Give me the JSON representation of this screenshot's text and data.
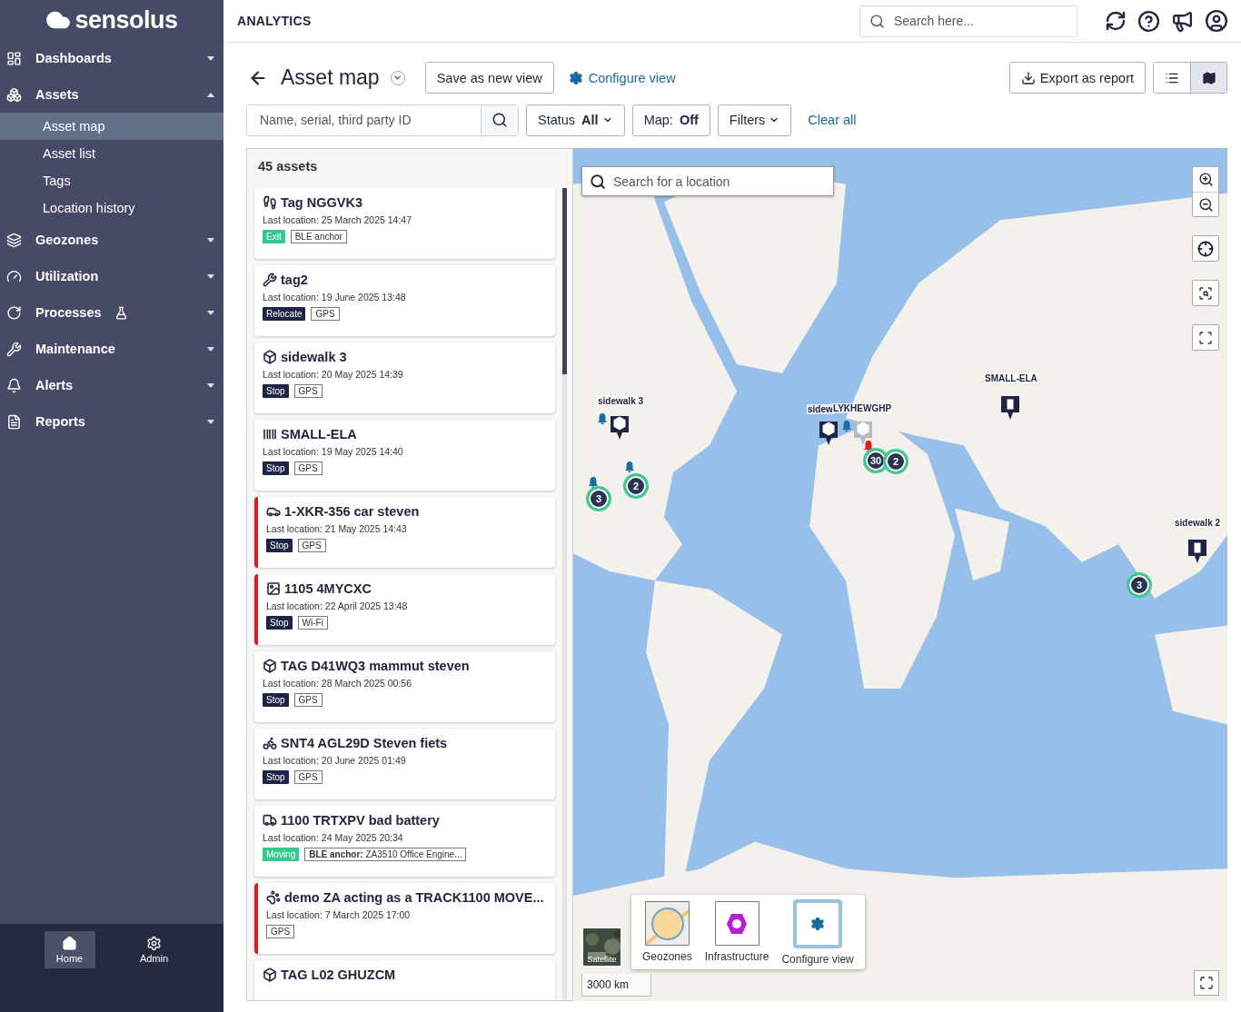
{
  "sidebar": {
    "logo": "sensolus",
    "items": [
      {
        "label": "Dashboards",
        "expanded": false
      },
      {
        "label": "Assets",
        "expanded": true,
        "children": [
          {
            "label": "Asset map",
            "selected": true
          },
          {
            "label": "Asset list",
            "selected": false
          },
          {
            "label": "Tags",
            "selected": false
          },
          {
            "label": "Location history",
            "selected": false
          }
        ]
      },
      {
        "label": "Geozones",
        "expanded": false
      },
      {
        "label": "Utilization",
        "expanded": false
      },
      {
        "label": "Processes",
        "expanded": false,
        "lab": true
      },
      {
        "label": "Maintenance",
        "expanded": false
      },
      {
        "label": "Alerts",
        "expanded": false
      },
      {
        "label": "Reports",
        "expanded": false
      }
    ],
    "footer": [
      {
        "label": "Home",
        "selected": true
      },
      {
        "label": "Admin",
        "selected": false
      }
    ]
  },
  "topbar": {
    "section": "ANALYTICS",
    "search": {
      "placeholder": "Search here..."
    }
  },
  "header": {
    "title": "Asset map",
    "save_button": "Save as new view",
    "configure_link": "Configure view",
    "export_button": "Export as report",
    "view_toggle": [
      {
        "selected": false
      },
      {
        "selected": true
      }
    ]
  },
  "filters": {
    "search": {
      "placeholder": "Name, serial, third party ID"
    },
    "dropdowns": [
      {
        "label": "Status",
        "value": "All",
        "caret": true
      },
      {
        "label": "Map:",
        "value": "Off",
        "caret": false
      },
      {
        "label": "Filters",
        "caret": true
      }
    ],
    "clear": "Clear all"
  },
  "assets": {
    "count": "45 assets",
    "items": [
      {
        "name": "Tag NGGVK3",
        "last_location": "Last location:  25 March 2025 14:47",
        "alert": false,
        "status": {
          "label": "Exit",
          "color": "#34c98e"
        },
        "source": "BLE anchor"
      },
      {
        "name": "tag2",
        "last_location": "Last location:  19 June 2025 13:48",
        "alert": false,
        "status": {
          "label": "Relocate",
          "color": "#1f2345"
        },
        "source": "GPS"
      },
      {
        "name": "sidewalk 3",
        "last_location": "Last location:  20 May 2025 14:39",
        "alert": false,
        "status": {
          "label": "Stop",
          "color": "#1f2345"
        },
        "source": "GPS"
      },
      {
        "name": "SMALL-ELA",
        "last_location": "Last location:  19 May 2025 14:40",
        "alert": false,
        "status": {
          "label": "Stop",
          "color": "#1f2345"
        },
        "source": "GPS"
      },
      {
        "name": "1-XKR-356 car steven",
        "last_location": "Last location:  21 May 2025 14:43",
        "alert": true,
        "status": {
          "label": "Stop",
          "color": "#1f2345"
        },
        "source": "GPS"
      },
      {
        "name": "1105 4MYCXC",
        "last_location": "Last location:  22 April 2025 13:48",
        "alert": true,
        "status": {
          "label": "Stop",
          "color": "#1f2345"
        },
        "source": "Wi-Fi"
      },
      {
        "name": "TAG D41WQ3 mammut steven",
        "last_location": "Last location:  28 March 2025 00:56",
        "alert": false,
        "status": {
          "label": "Stop",
          "color": "#1f2345"
        },
        "source": "GPS"
      },
      {
        "name": "SNT4 AGL29D Steven fiets",
        "last_location": "Last location:  20 June 2025 01:49",
        "alert": false,
        "status": {
          "label": "Stop",
          "color": "#1f2345"
        },
        "source": "GPS"
      },
      {
        "name": "1100 TRTXPV bad battery",
        "last_location": "Last location:  24 May 2025 20:34",
        "alert": false,
        "status": {
          "label": "Moving",
          "color": "#34c98e"
        },
        "source": "**BLE anchor:** ZA3510 Office Engine..."
      },
      {
        "name": "demo ZA acting as a TRACK1100 MOVE...",
        "last_location": "Last location:  7 March 2025 17:00",
        "alert": true,
        "source": "GPS"
      },
      {
        "name": "TAG L02 GHUZCM",
        "alert": false
      }
    ]
  },
  "map": {
    "search": {
      "placeholder": "Search for a location"
    },
    "markers": [
      {
        "label": "sidewalk 3",
        "kind": "light"
      },
      {
        "label": "sidew",
        "kind": "light"
      },
      {
        "label": "LYKHEWGHP",
        "kind": "grey"
      },
      {
        "label": "SMALL-ELA",
        "kind": "dark"
      },
      {
        "label": "sidewalk 2",
        "kind": "dark"
      }
    ],
    "alerts": [
      {
        "color": "#1b6f9e"
      },
      {
        "color": "#1b6f9e"
      },
      {
        "color": "#1b6f9e"
      },
      {
        "color": "#1b6f9e"
      },
      {
        "color": "#e01b1b"
      }
    ],
    "clusters": [
      {
        "count": "30"
      },
      {
        "count": "2"
      },
      {
        "count": "2"
      },
      {
        "count": "3"
      },
      {
        "count": "3"
      }
    ],
    "satellite": "Satellite",
    "layers": [
      {
        "label": "Geozones",
        "selected": false
      },
      {
        "label": "Infrastructure",
        "selected": false
      },
      {
        "label": "Configure view",
        "selected": true
      }
    ],
    "scale": "3000 km"
  }
}
